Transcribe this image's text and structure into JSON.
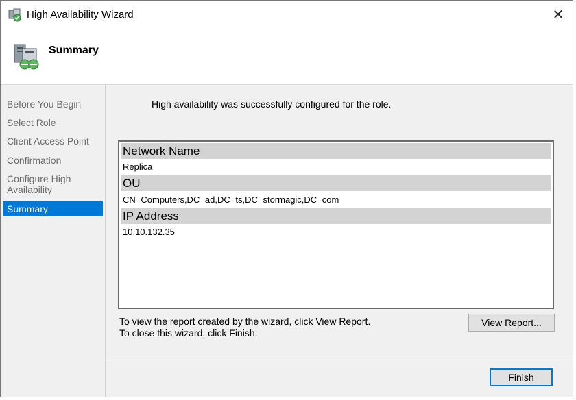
{
  "window": {
    "title": "High Availability Wizard",
    "close_glyph": "✕"
  },
  "header": {
    "title": "Summary"
  },
  "sidebar": {
    "items": [
      {
        "label": "Before You Begin"
      },
      {
        "label": "Select Role"
      },
      {
        "label": "Client Access Point"
      },
      {
        "label": "Confirmation"
      },
      {
        "label": "Configure High Availability"
      },
      {
        "label": "Summary",
        "active": true
      }
    ]
  },
  "main": {
    "message": "High availability was successfully configured for the role.",
    "report": [
      {
        "heading": "Network Name",
        "value": "Replica"
      },
      {
        "heading": "OU",
        "value": "CN=Computers,DC=ad,DC=ts,DC=stormagic,DC=com"
      },
      {
        "heading": "IP Address",
        "value": "10.10.132.35"
      }
    ],
    "hint_line1": "To view the report created by the wizard, click View Report.",
    "hint_line2": "To close this wizard, click Finish.",
    "view_report_label": "View Report...",
    "finish_label": "Finish"
  },
  "colors": {
    "accent": "#0078d7",
    "sidebar_bg": "#f0f0f0",
    "row_header_bg": "#d3d3d3"
  },
  "icons": {
    "app": "cluster-wizard-icon",
    "header": "cluster-server-icon",
    "close": "close-icon"
  }
}
